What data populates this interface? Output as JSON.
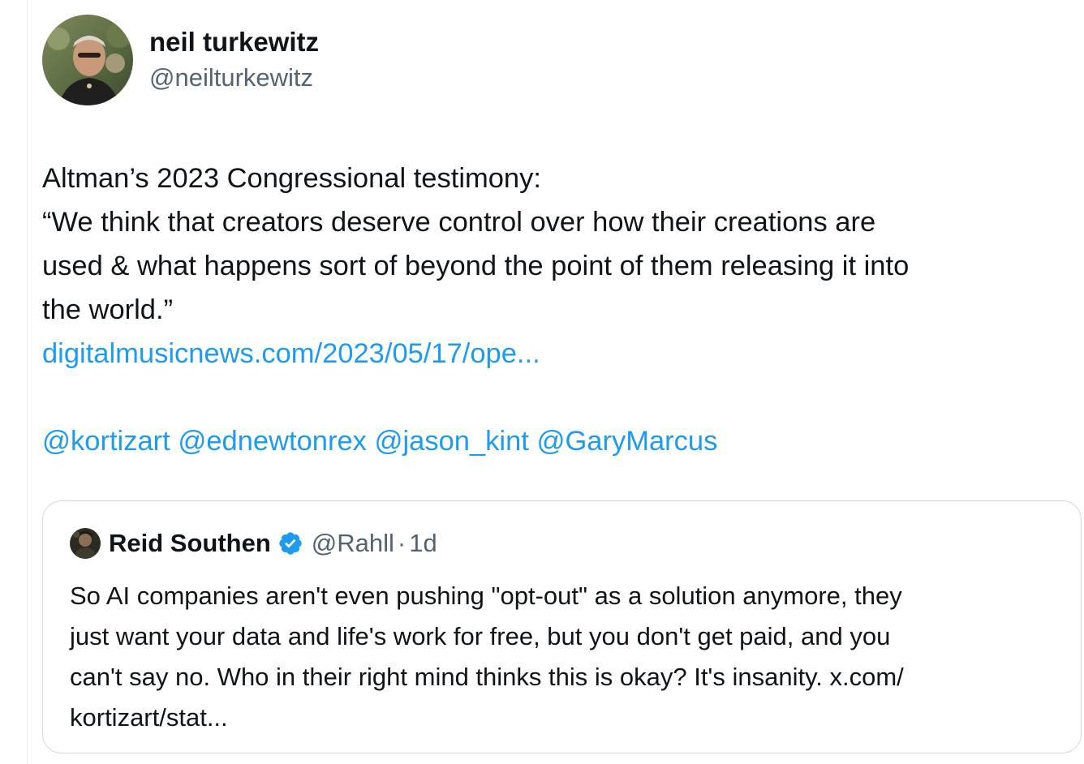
{
  "tweet": {
    "author": {
      "display_name": "neil turkewitz",
      "handle": "@neilturkewitz"
    },
    "text_lines": [
      "Altman’s 2023 Congressional testimony:",
      "“We think that creators deserve control over how their creations are",
      "used & what happens sort of beyond the point of them releasing it into",
      "the world.”"
    ],
    "link": "digitalmusicnews.com/2023/05/17/ope...",
    "mentions": [
      "@kortizart",
      "@ednewtonrex",
      "@jason_kint",
      "@GaryMarcus"
    ]
  },
  "quoted_tweet": {
    "author": {
      "display_name": "Reid Southen",
      "handle": "@Rahll",
      "verified": true
    },
    "separator": "·",
    "time": "1d",
    "text_lines": [
      "So AI companies aren't even pushing \"opt-out\" as a solution anymore, they",
      "just want your data and life's work for free, but you don't get paid, and you",
      "can't say no. Who in their right mind thinks this is okay? It's insanity. x.com/",
      "kortizart/stat..."
    ]
  },
  "icons": {
    "verified": "verified-badge-icon"
  },
  "colors": {
    "text": "#0f1419",
    "secondary": "#536471",
    "link": "#1d9bf0",
    "border": "#cfd9de"
  }
}
